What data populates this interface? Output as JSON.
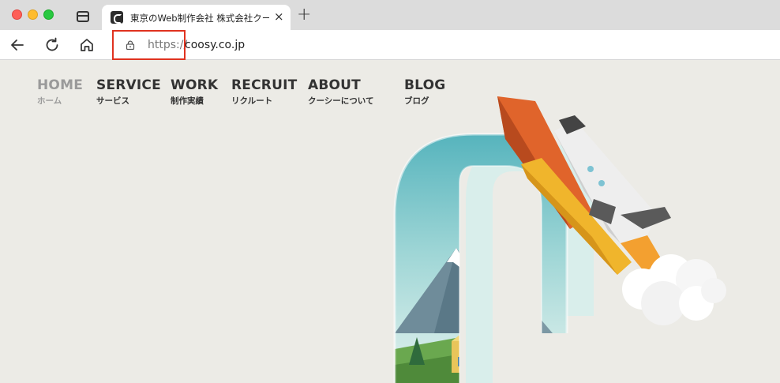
{
  "browser": {
    "tab": {
      "title": "東京のWeb制作会社 株式会社クー",
      "close_symbol": "×"
    },
    "new_tab_symbol": "+",
    "address_bar": {
      "scheme": "https://",
      "host": "coosy.co.jp"
    }
  },
  "site": {
    "nav": [
      {
        "en": "HOME",
        "jp": "ホーム",
        "active": true
      },
      {
        "en": "SERVICE",
        "jp": "サービス",
        "active": false
      },
      {
        "en": "WORK",
        "jp": "制作実績",
        "active": false
      },
      {
        "en": "RECRUIT",
        "jp": "リクルート",
        "active": false
      },
      {
        "en": "ABOUT",
        "jp": "クーシーについて",
        "active": false
      },
      {
        "en": "BLOG",
        "jp": "ブログ",
        "active": false
      }
    ]
  },
  "colors": {
    "page_background": "#ecebe6",
    "nav_text": "#333333",
    "nav_active_text": "#9a9a9a",
    "highlight_box": "#e0321f"
  },
  "icons": [
    "tab-strip-icon",
    "favicon-icon",
    "close-icon",
    "plus-icon",
    "back-arrow-icon",
    "reload-icon",
    "home-icon",
    "lock-icon"
  ]
}
